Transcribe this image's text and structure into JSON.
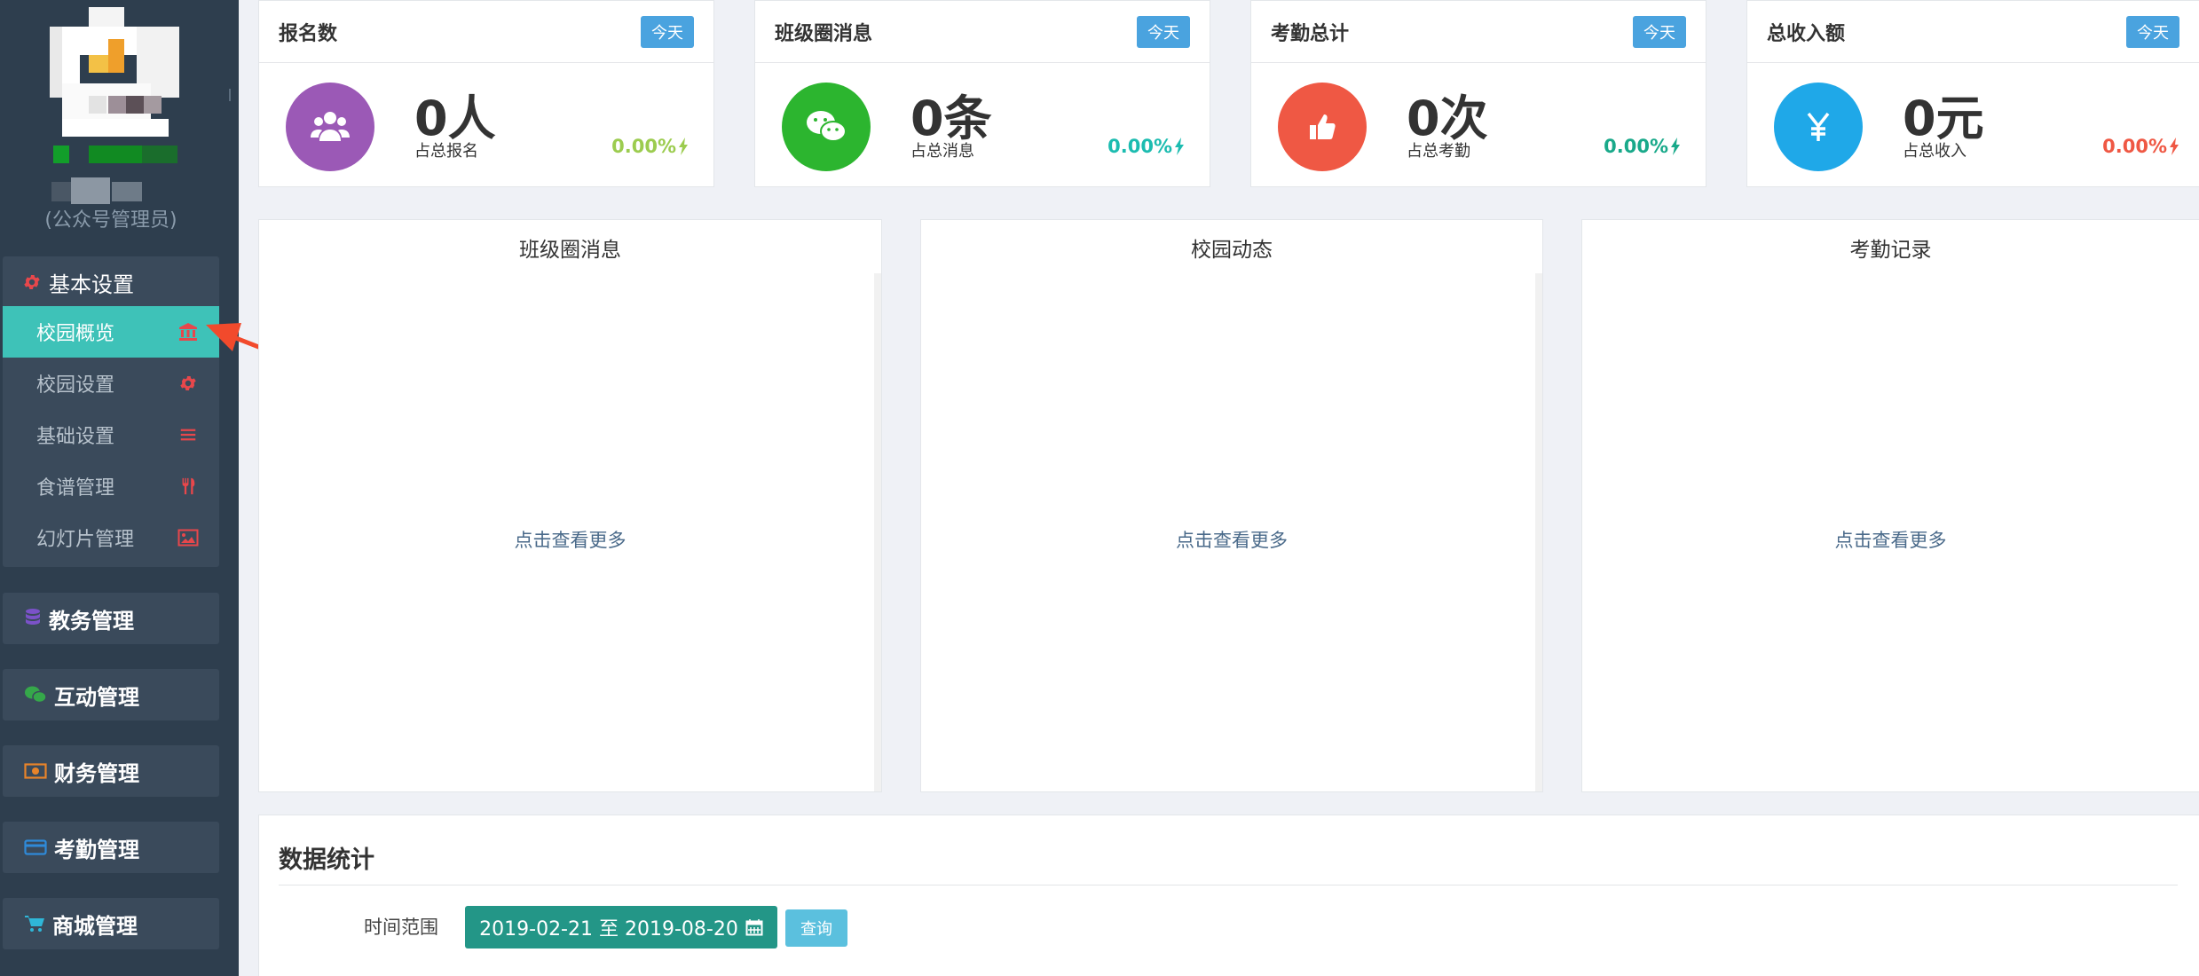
{
  "sidebar": {
    "role": "(公众号管理员)",
    "group_open": {
      "label": "基本设置",
      "icon": "gear-icon",
      "icon_color": "#e8474b"
    },
    "sub_items": [
      {
        "label": "校园概览",
        "icon": "bank-icon",
        "active": true
      },
      {
        "label": "校园设置",
        "icon": "gear-icon"
      },
      {
        "label": "基础设置",
        "icon": "list-icon"
      },
      {
        "label": "食谱管理",
        "icon": "cutlery-icon"
      },
      {
        "label": "幻灯片管理",
        "icon": "picture-icon"
      }
    ],
    "menus": [
      {
        "label": "教务管理",
        "icon": "database-icon",
        "color": "#7b52c9"
      },
      {
        "label": "互动管理",
        "icon": "wechat-icon",
        "color": "#35a84a"
      },
      {
        "label": "财务管理",
        "icon": "money-icon",
        "color": "#e8842a"
      },
      {
        "label": "考勤管理",
        "icon": "credit-card-icon",
        "color": "#2f8ad8"
      },
      {
        "label": "商城管理",
        "icon": "cart-icon",
        "color": "#2fb7d8"
      }
    ]
  },
  "cards": [
    {
      "title": "报名数",
      "badge": "今天",
      "value": "0人",
      "sub": "占总报名",
      "percent": "0.00%",
      "circle_color": "#9b59b6",
      "pct_color": "#9ccc4f",
      "icon": "users-icon"
    },
    {
      "title": "班级圈消息",
      "badge": "今天",
      "value": "0条",
      "sub": "占总消息",
      "percent": "0.00%",
      "circle_color": "#2cb52f",
      "pct_color": "#1cbcb0",
      "icon": "wechat-icon"
    },
    {
      "title": "考勤总计",
      "badge": "今天",
      "value": "0次",
      "sub": "占总考勤",
      "percent": "0.00%",
      "circle_color": "#ef5844",
      "pct_color": "#19a98a",
      "icon": "thumbs-up-icon"
    },
    {
      "title": "总收入额",
      "badge": "今天",
      "value": "0元",
      "sub": "占总收入",
      "percent": "0.00%",
      "circle_color": "#1fa8e8",
      "pct_color": "#ef5844",
      "icon": "yen-icon"
    }
  ],
  "panels": [
    {
      "title": "班级圈消息",
      "more": "点击查看更多"
    },
    {
      "title": "校园动态",
      "more": "点击查看更多"
    },
    {
      "title": "考勤记录",
      "more": "点击查看更多"
    }
  ],
  "stats": {
    "title": "数据统计",
    "range_label": "时间范围",
    "range_value": "2019-02-21 至 2019-08-20",
    "query_label": "查询"
  }
}
